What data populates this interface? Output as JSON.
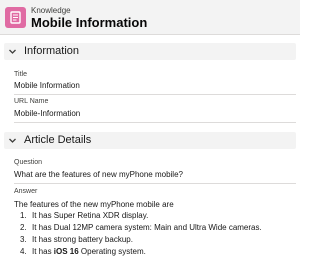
{
  "header": {
    "object_label": "Knowledge",
    "record_title": "Mobile Information",
    "icon": "knowledge-book-icon",
    "icon_color": "#e06ba3"
  },
  "sections": {
    "information": {
      "title": "Information",
      "fields": {
        "title": {
          "label": "Title",
          "value": "Mobile Information"
        },
        "url_name": {
          "label": "URL Name",
          "value": "Mobile-Information"
        }
      }
    },
    "article_details": {
      "title": "Article Details",
      "fields": {
        "question": {
          "label": "Question",
          "value": "What are the features of new myPhone mobile?"
        },
        "answer": {
          "label": "Answer",
          "intro": "The features of the new myPhone mobile are",
          "items": [
            {
              "num": "1.",
              "text": "It has Super Retina XDR display."
            },
            {
              "num": "2.",
              "text": "It has Dual 12MP camera system: Main and Ultra Wide cameras."
            },
            {
              "num": "3.",
              "text": "It has strong battery backup."
            },
            {
              "num": "4.",
              "pre": "It has ",
              "bold": "iOS 16",
              "post": " Operating system."
            }
          ]
        }
      }
    }
  },
  "icons": {
    "section_toggle": "chevron-down-icon"
  }
}
